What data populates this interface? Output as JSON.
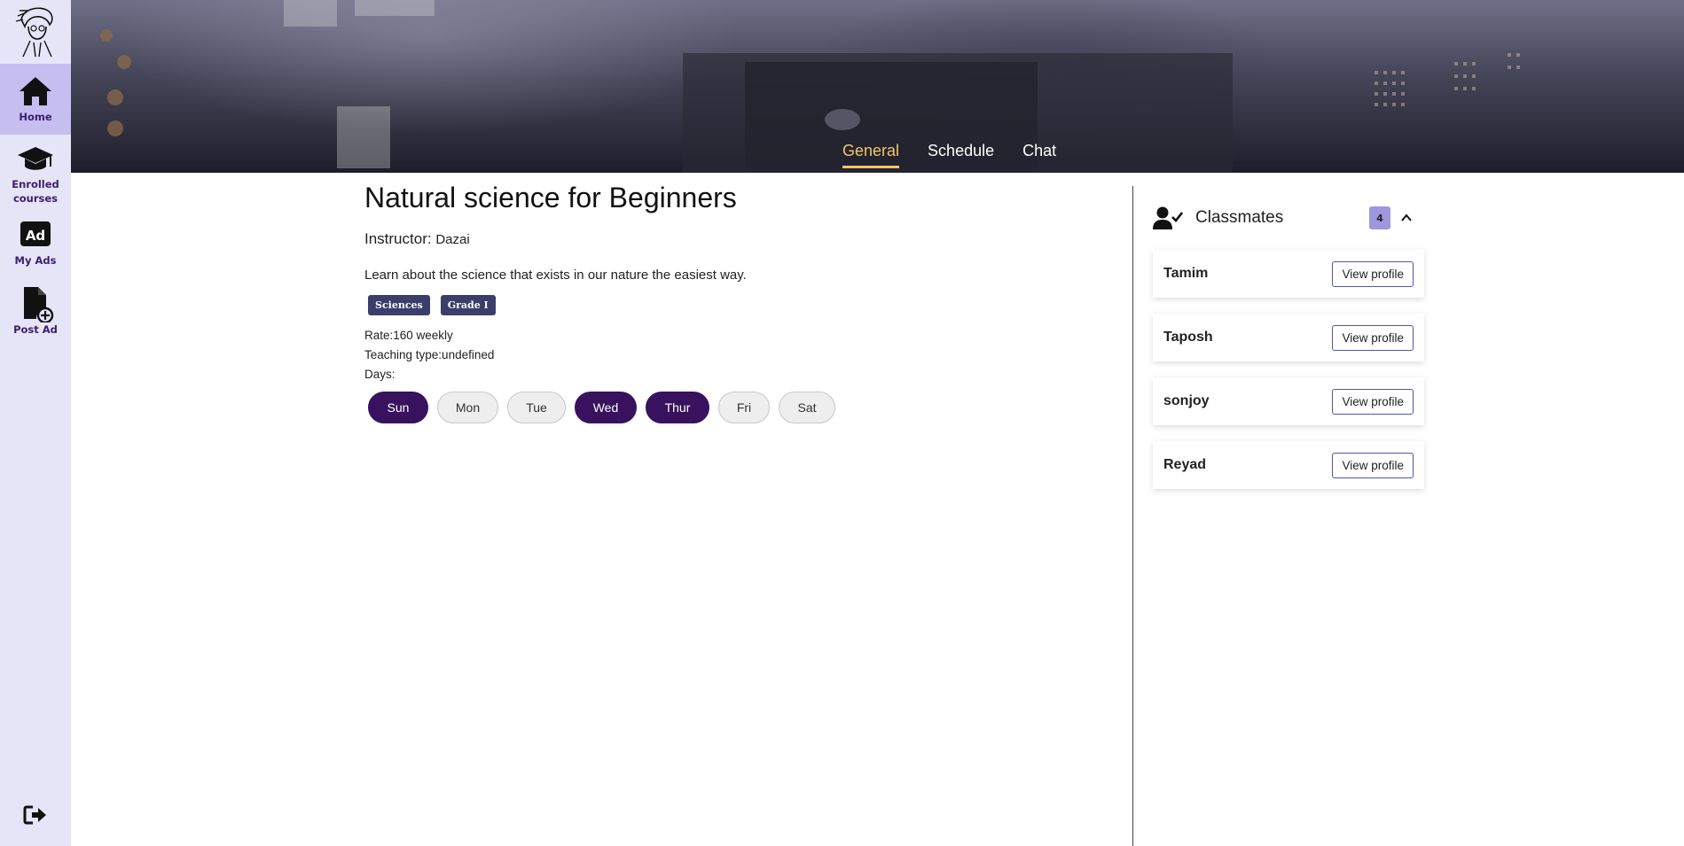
{
  "sidebar": {
    "items": [
      {
        "label": "Home",
        "icon": "home-icon"
      },
      {
        "label": "Enrolled courses",
        "icon": "graduation-cap-icon"
      },
      {
        "label": "My Ads",
        "icon": "ad-icon"
      },
      {
        "label": "Post Ad",
        "icon": "file-plus-icon"
      }
    ],
    "logout_icon": "logout-icon",
    "logo": "avatar-logo"
  },
  "tabs": {
    "general": "General",
    "schedule": "Schedule",
    "chat": "Chat"
  },
  "course": {
    "title": "Natural science for Beginners",
    "instructor_label": "Instructor: ",
    "instructor_name": "Dazai",
    "description": "Learn about the science that exists in our nature the easiest way.",
    "tags": [
      "Sciences",
      "Grade I"
    ],
    "rate": "Rate:160 weekly",
    "teaching_type": "Teaching type:undefined",
    "days_label": "Days:",
    "days": [
      {
        "label": "Sun",
        "selected": true
      },
      {
        "label": "Mon",
        "selected": false
      },
      {
        "label": "Tue",
        "selected": false
      },
      {
        "label": "Wed",
        "selected": true
      },
      {
        "label": "Thur",
        "selected": true
      },
      {
        "label": "Fri",
        "selected": false
      },
      {
        "label": "Sat",
        "selected": false
      }
    ]
  },
  "classmates": {
    "title": "Classmates",
    "count": "4",
    "button_label": "View profile",
    "list": [
      "Tamim",
      "Taposh",
      "sonjoy",
      "Reyad"
    ]
  },
  "colors": {
    "sidebar_bg": "#e6e4f7",
    "sidebar_active": "#c6bdf0",
    "accent_purple": "#38125e",
    "tab_active": "#f3c56a",
    "tag_bg": "#3b3e6b"
  }
}
